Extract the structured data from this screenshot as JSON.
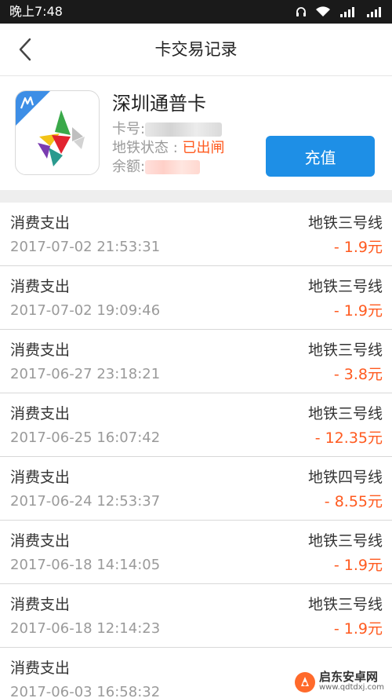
{
  "status_bar": {
    "time": "晚上7:48"
  },
  "header": {
    "title": "卡交易记录"
  },
  "card": {
    "name": "深圳通普卡",
    "number_label": "卡号:",
    "subway_status_label": "地铁状态 : ",
    "subway_status_value": "已出闸",
    "balance_label": "余额:",
    "recharge_label": "充值"
  },
  "transactions": [
    {
      "type": "消费支出",
      "time": "2017-07-02 21:53:31",
      "line": "地铁三号线",
      "amount": "- 1.9元"
    },
    {
      "type": "消费支出",
      "time": "2017-07-02 19:09:46",
      "line": "地铁三号线",
      "amount": "- 1.9元"
    },
    {
      "type": "消费支出",
      "time": "2017-06-27 23:18:21",
      "line": "地铁三号线",
      "amount": "- 3.8元"
    },
    {
      "type": "消费支出",
      "time": "2017-06-25 16:07:42",
      "line": "地铁三号线",
      "amount": "- 12.35元"
    },
    {
      "type": "消费支出",
      "time": "2017-06-24 12:53:37",
      "line": "地铁四号线",
      "amount": "- 8.55元"
    },
    {
      "type": "消费支出",
      "time": "2017-06-18 14:14:05",
      "line": "地铁三号线",
      "amount": "- 1.9元"
    },
    {
      "type": "消费支出",
      "time": "2017-06-18 12:14:23",
      "line": "地铁三号线",
      "amount": "- 1.9元"
    },
    {
      "type": "消费支出",
      "time": "2017-06-03 16:58:32",
      "line": "",
      "amount": ""
    }
  ],
  "watermark": {
    "name": "启东安卓网",
    "url": "www.qdtdxj.com"
  },
  "colors": {
    "accent": "#1e8fe6",
    "amount": "#ff5a1f",
    "status_bar": "#1a1a1a"
  },
  "icons": [
    "headphones-icon",
    "wifi-icon",
    "signal-icon",
    "back-arrow-icon",
    "card-logo-icon"
  ]
}
